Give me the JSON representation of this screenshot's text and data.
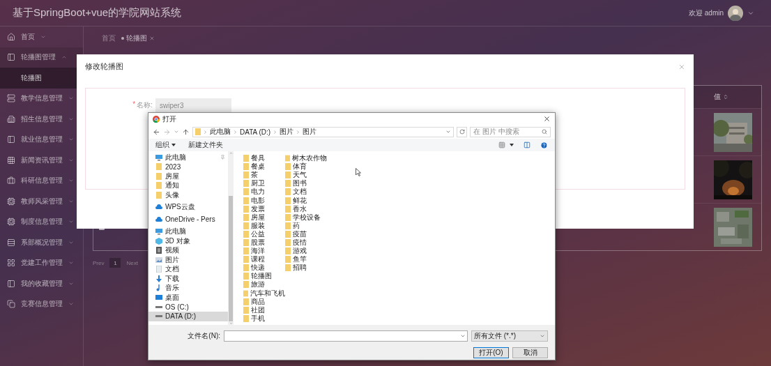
{
  "header": {
    "title": "基于SpringBoot+vue的学院网站系统",
    "welcome": "欢迎 admin"
  },
  "sidebar": {
    "items": [
      {
        "label": "首页",
        "expanded": false
      },
      {
        "label": "轮播图管理",
        "expanded": true,
        "children": [
          {
            "label": "轮播图",
            "selected": true
          }
        ]
      },
      {
        "label": "教学信息管理",
        "expanded": false
      },
      {
        "label": "招生信息管理",
        "expanded": false
      },
      {
        "label": "就业信息管理",
        "expanded": false
      },
      {
        "label": "新闻资讯管理",
        "expanded": false
      },
      {
        "label": "科研信息管理",
        "expanded": false
      },
      {
        "label": "教师风采管理",
        "expanded": false
      },
      {
        "label": "制度信息管理",
        "expanded": false
      },
      {
        "label": "系部概况管理",
        "expanded": false
      },
      {
        "label": "党建工作管理",
        "expanded": false
      },
      {
        "label": "我的收藏管理",
        "expanded": false
      },
      {
        "label": "竞赛信息管理",
        "expanded": false
      }
    ]
  },
  "tabs": [
    {
      "label": "首页",
      "selected": false
    },
    {
      "label": "轮播图",
      "selected": true
    }
  ],
  "table": {
    "columns": [
      {
        "label": "值"
      }
    ],
    "rows": [
      {
        "image": {
          "kind": "picture"
        }
      },
      {
        "image": {
          "kind": "picture"
        }
      },
      {
        "checked": false,
        "image": {
          "kind": "picture"
        }
      }
    ]
  },
  "pagination": {
    "prev": "Prev",
    "pages": [
      {
        "label": "1",
        "selected": true
      }
    ],
    "next": "Next"
  },
  "modal": {
    "title": "修改轮播图",
    "fields": [
      {
        "mark": "*",
        "label": "名称:",
        "value": "swiper3"
      }
    ]
  },
  "file_dialog": {
    "title": "打开",
    "path": [
      "此电脑",
      "DATA (D:)",
      "图片",
      "图片"
    ],
    "search": {
      "placeholder": "在 图片 中搜索"
    },
    "toolbar": [
      {
        "label": "组织",
        "menu": true
      },
      {
        "label": "新建文件夹",
        "menu": false
      }
    ],
    "nav": [
      {
        "items": [
          {
            "label": "此电脑",
            "kind": "pc",
            "pinned": true,
            "selected": false
          },
          {
            "label": "2023",
            "kind": "folder",
            "pinned": false,
            "selected": false
          },
          {
            "label": "房屋",
            "kind": "folder",
            "pinned": false,
            "selected": false
          },
          {
            "label": "通知",
            "kind": "folder",
            "pinned": false,
            "selected": false
          },
          {
            "label": "头像",
            "kind": "folder",
            "pinned": false,
            "selected": false
          }
        ]
      },
      {
        "items": [
          {
            "label": "WPS云盘",
            "kind": "cloud",
            "pinned": false,
            "selected": false
          }
        ]
      },
      {
        "items": [
          {
            "label": "OneDrive - Pers",
            "kind": "cloud",
            "pinned": false,
            "selected": false
          }
        ]
      },
      {
        "items": [
          {
            "label": "此电脑",
            "kind": "pc",
            "pinned": false,
            "selected": false
          },
          {
            "label": "3D 对象",
            "kind": "cube",
            "pinned": false,
            "selected": false
          },
          {
            "label": "视频",
            "kind": "video",
            "pinned": false,
            "selected": false
          },
          {
            "label": "图片",
            "kind": "pictures",
            "pinned": false,
            "selected": false
          },
          {
            "label": "文档",
            "kind": "docs",
            "pinned": false,
            "selected": false
          },
          {
            "label": "下载",
            "kind": "download",
            "pinned": false,
            "selected": false
          },
          {
            "label": "音乐",
            "kind": "music",
            "pinned": false,
            "selected": false
          },
          {
            "label": "桌面",
            "kind": "desktop",
            "pinned": false,
            "selected": false
          },
          {
            "label": "OS (C:)",
            "kind": "drive",
            "pinned": false,
            "selected": false
          },
          {
            "label": "DATA (D:)",
            "kind": "drive",
            "pinned": false,
            "selected": true
          }
        ]
      }
    ],
    "folders": [
      "餐具",
      "餐桌",
      "茶",
      "厨卫",
      "电力",
      "电影",
      "发票",
      "房屋",
      "服装",
      "公益",
      "股票",
      "海洋",
      "课程",
      "快递",
      "轮播图",
      "旅游",
      "汽车和飞机",
      "商品",
      "社团",
      "手机",
      "树木农作物",
      "体育",
      "天气",
      "图书",
      "文档",
      "鲜花",
      "香水",
      "学校设备",
      "药",
      "疫苗",
      "疫情",
      "游戏",
      "鱼竿",
      "招聘"
    ],
    "filename": {
      "label": "文件名(N):"
    },
    "filetype": "所有文件 (*.*)",
    "buttons": [
      {
        "label": "打开(O)",
        "kind": "primary"
      },
      {
        "label": "取消",
        "kind": "default"
      }
    ]
  }
}
